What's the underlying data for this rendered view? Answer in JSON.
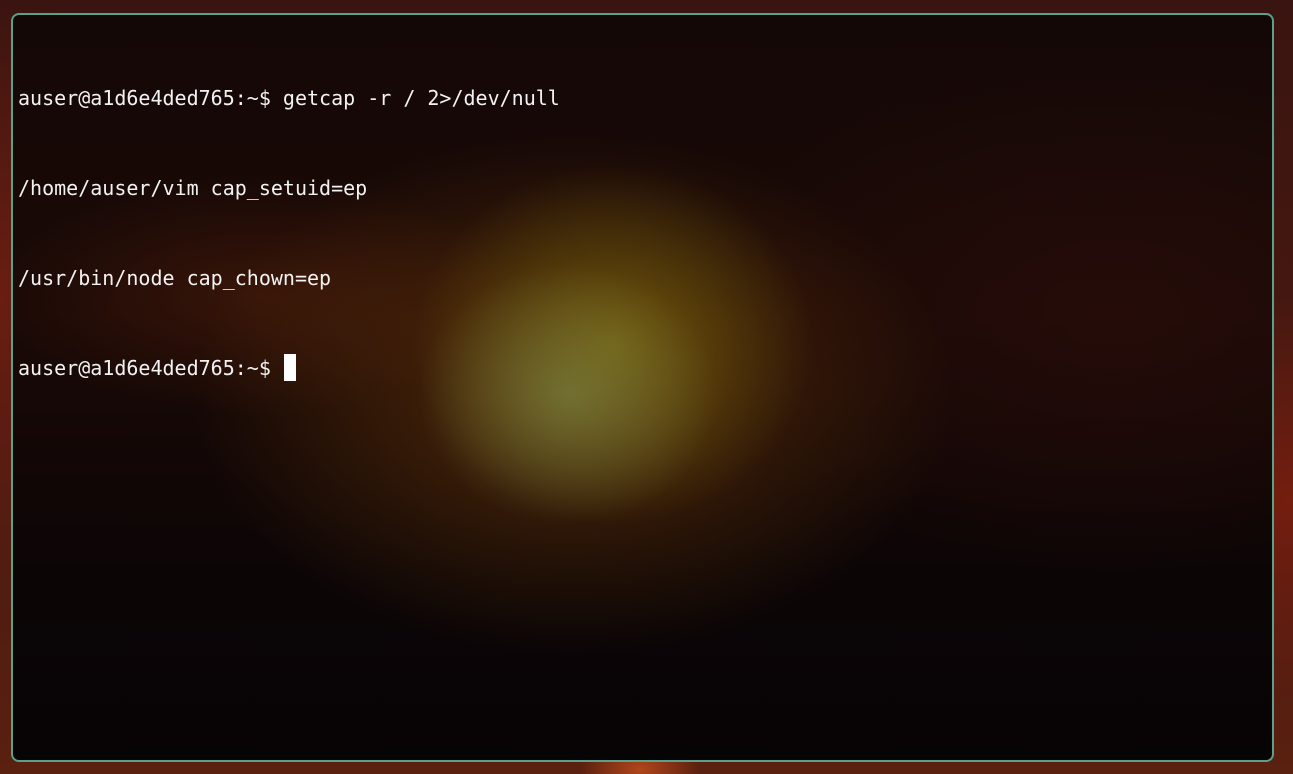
{
  "terminal": {
    "lines": [
      "auser@a1d6e4ded765:~$ getcap -r / 2>/dev/null",
      "/home/auser/vim cap_setuid=ep",
      "/usr/bin/node cap_chown=ep"
    ],
    "prompt": "auser@a1d6e4ded765:~$",
    "colors": {
      "text": "#f2f2f2",
      "border": "#5aa08a",
      "cursor": "#ffffff"
    }
  }
}
